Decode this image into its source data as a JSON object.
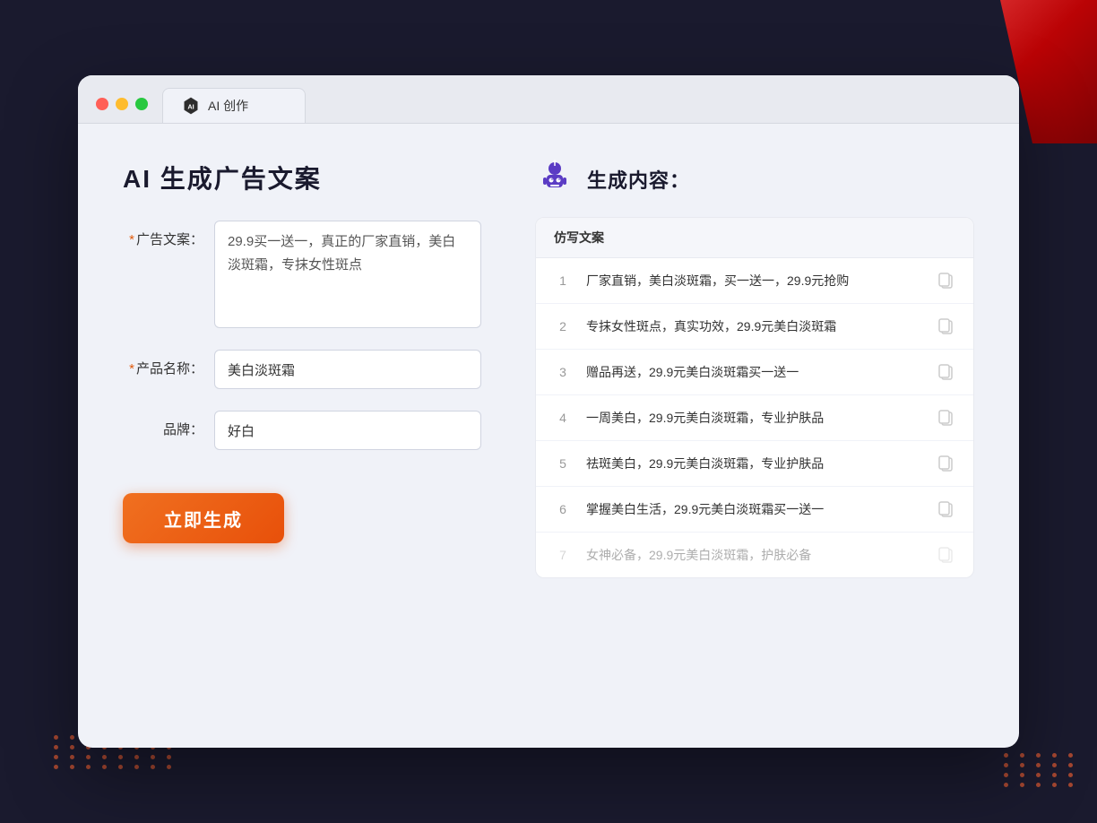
{
  "browser": {
    "tab_title": "AI 创作",
    "controls": {
      "close": "close",
      "minimize": "minimize",
      "maximize": "maximize"
    }
  },
  "page": {
    "title": "AI 生成广告文案",
    "form": {
      "ad_copy_label": "广告文案：",
      "ad_copy_required": "*",
      "ad_copy_value": "29.9买一送一，真正的厂家直销，美白淡斑霜，专抹女性斑点",
      "product_name_label": "产品名称：",
      "product_name_required": "*",
      "product_name_value": "美白淡斑霜",
      "brand_label": "品牌：",
      "brand_value": "好白",
      "generate_button": "立即生成"
    },
    "result": {
      "header_icon": "robot",
      "header_title": "生成内容：",
      "column_header": "仿写文案",
      "items": [
        {
          "num": "1",
          "text": "厂家直销，美白淡斑霜，买一送一，29.9元抢购",
          "faded": false
        },
        {
          "num": "2",
          "text": "专抹女性斑点，真实功效，29.9元美白淡斑霜",
          "faded": false
        },
        {
          "num": "3",
          "text": "赠品再送，29.9元美白淡斑霜买一送一",
          "faded": false
        },
        {
          "num": "4",
          "text": "一周美白，29.9元美白淡斑霜，专业护肤品",
          "faded": false
        },
        {
          "num": "5",
          "text": "祛斑美白，29.9元美白淡斑霜，专业护肤品",
          "faded": false
        },
        {
          "num": "6",
          "text": "掌握美白生活，29.9元美白淡斑霜买一送一",
          "faded": false
        },
        {
          "num": "7",
          "text": "女神必备，29.9元美白淡斑霜，护肤必备",
          "faded": true
        }
      ]
    }
  },
  "colors": {
    "accent_orange": "#f07020",
    "brand_purple": "#5b3cc4",
    "required_red": "#e05a0c"
  }
}
